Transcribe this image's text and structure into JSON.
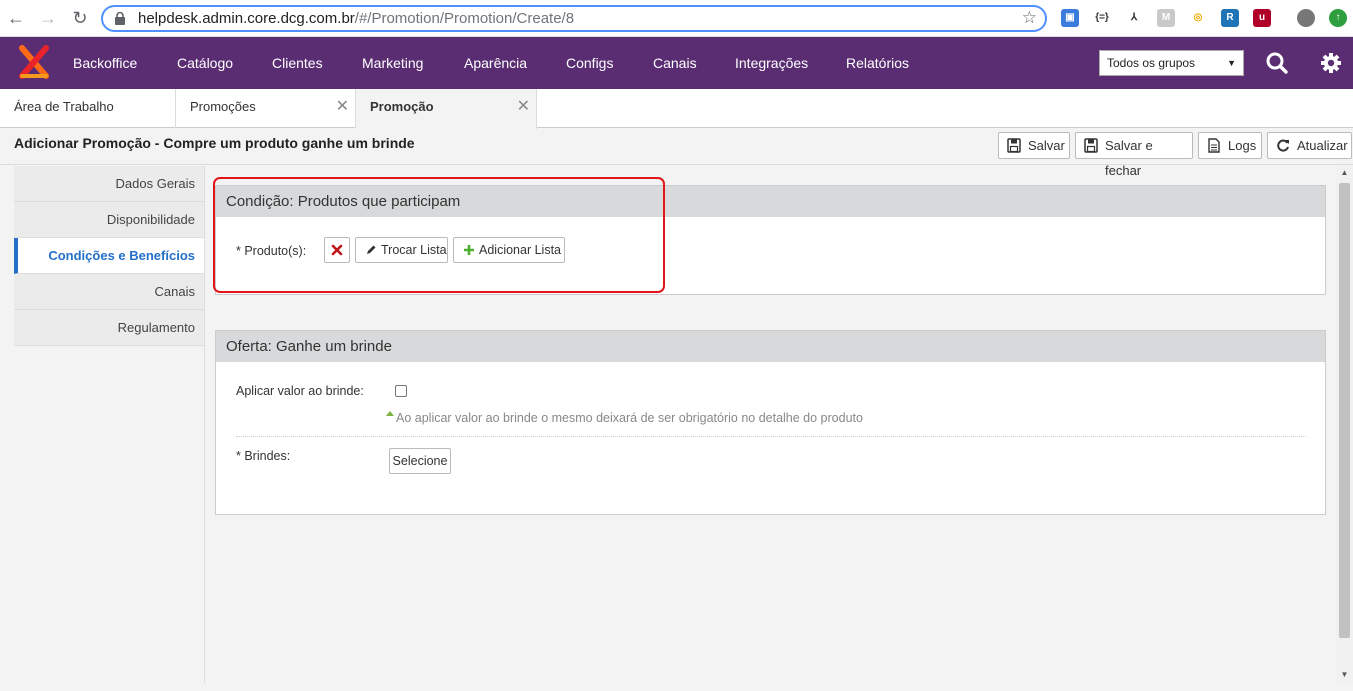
{
  "browser": {
    "url_host": "helpdesk.admin.core.dcg.com.br",
    "url_path": "/#/Promotion/Promotion/Create/8"
  },
  "topnav": {
    "menu": [
      "Backoffice",
      "Catálogo",
      "Clientes",
      "Marketing",
      "Aparência",
      "Configs",
      "Canais",
      "Integrações",
      "Relatórios"
    ],
    "group_select": "Todos os grupos",
    "accent": "#5a2d73"
  },
  "tabs": [
    {
      "label": "Área de Trabalho"
    },
    {
      "label": "Promoções"
    },
    {
      "label": "Promoção"
    }
  ],
  "page": {
    "title": "Adicionar Promoção - Compre um produto ganhe um brinde",
    "toolbar": {
      "save": "Salvar",
      "save_close": "Salvar e fechar",
      "logs": "Logs",
      "refresh": "Atualizar"
    }
  },
  "sidebar": {
    "items": [
      "Dados Gerais",
      "Disponibilidade",
      "Condições e Benefícios",
      "Canais",
      "Regulamento"
    ],
    "active": "Condições e Benefícios"
  },
  "condition_panel": {
    "title": "Condição: Produtos que participam",
    "product_label": "* Produto(s):",
    "change_list": "Trocar Lista",
    "add_list": "Adicionar Lista"
  },
  "offer_panel": {
    "title": "Oferta: Ganhe um brinde",
    "apply_value_label": "Aplicar valor ao brinde:",
    "apply_value_checked": false,
    "hint": "Ao aplicar valor ao brinde o mesmo deixará de ser obrigatório no detalhe do produto",
    "gifts_label": "* Brindes:",
    "select_button": "Selecione"
  },
  "icons": {
    "back": "arrow-left-icon",
    "forward": "arrow-right-icon",
    "reload": "reload-icon",
    "lock": "lock-icon",
    "star": "star-icon",
    "search": "search-icon",
    "settings": "gear-icon",
    "remove": "x-icon",
    "edit": "pencil-icon",
    "add": "plus-icon"
  }
}
